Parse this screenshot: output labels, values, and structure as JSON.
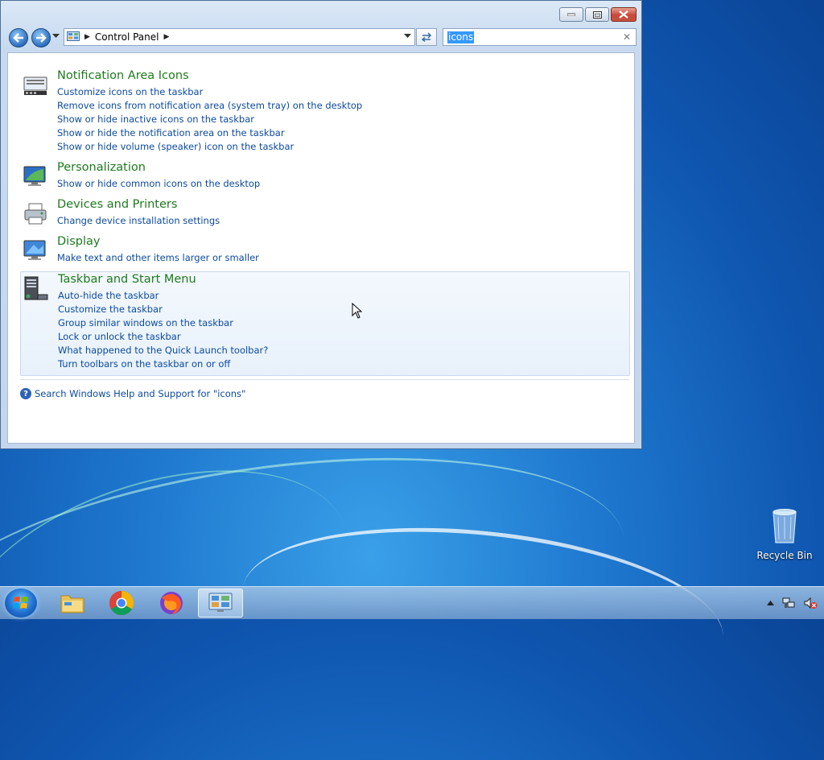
{
  "window": {
    "address": {
      "crumb": "Control Panel"
    },
    "search": {
      "value": "icons"
    },
    "results": [
      {
        "title": "Notification Area Icons",
        "links": [
          "Customize icons on the taskbar",
          "Remove icons from notification area (system tray) on the desktop",
          "Show or hide inactive icons on the taskbar",
          "Show or hide the notification area on the taskbar",
          "Show or hide volume (speaker) icon on the taskbar"
        ]
      },
      {
        "title": "Personalization",
        "links": [
          "Show or hide common icons on the desktop"
        ]
      },
      {
        "title": "Devices and Printers",
        "links": [
          "Change device installation settings"
        ]
      },
      {
        "title": "Display",
        "links": [
          "Make text and other items larger or smaller"
        ]
      },
      {
        "title": "Taskbar and Start Menu",
        "links": [
          "Auto-hide the taskbar",
          "Customize the taskbar",
          "Group similar windows on the taskbar",
          "Lock or unlock the taskbar",
          "What happened to the Quick Launch toolbar?",
          "Turn toolbars on the taskbar on or off"
        ]
      }
    ],
    "help_link": "Search Windows Help and Support for \"icons\""
  },
  "desktop": {
    "icons": [
      {
        "label": "Recycle Bin",
        "icon": "recycle-bin-icon"
      }
    ]
  },
  "taskbar": {
    "apps": [
      {
        "name": "File Explorer",
        "icon": "folder-icon"
      },
      {
        "name": "Google Chrome",
        "icon": "chrome-icon"
      },
      {
        "name": "Firefox",
        "icon": "firefox-icon"
      },
      {
        "name": "Control Panel",
        "icon": "control-panel-icon",
        "active": true
      }
    ],
    "tray_icons": [
      "show-hidden-icons",
      "network-icon",
      "volume-muted-icon"
    ]
  },
  "colors": {
    "link": "#0b4a9e",
    "heading": "#1e7a1e",
    "selection": "#3399ff",
    "close_button": "#c7483a"
  }
}
